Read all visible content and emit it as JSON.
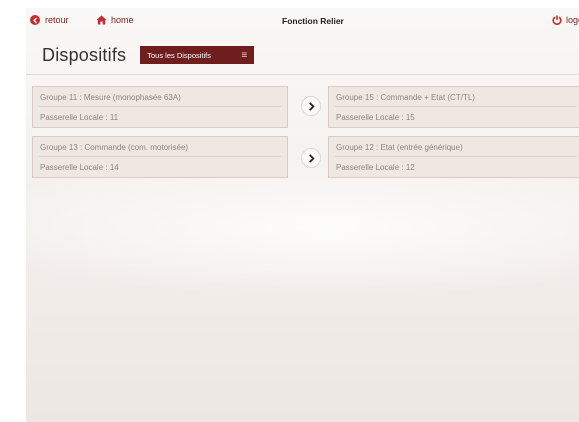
{
  "nav": {
    "retour_label": "retour",
    "home_label": "home",
    "title": "Fonction Relier",
    "logout_label": "logout"
  },
  "header": {
    "title": "Dispositifs",
    "filter_label": "Tous les Dispositifs"
  },
  "pairs": [
    {
      "left": {
        "title": "Groupe 11 : Mesure (monophasée 63A)",
        "subtitle": "Passerelle Locale : 11"
      },
      "right": {
        "title": "Groupe 15 : Commande + Etat (CT/TL)",
        "subtitle": "Passerelle Locale : 15"
      }
    },
    {
      "left": {
        "title": "Groupe 13 : Commande (com. motorisée)",
        "subtitle": "Passerelle Locale : 14"
      },
      "right": {
        "title": "Groupe 12 : Etat (entrée générique)",
        "subtitle": "Passerelle Locale : 12"
      }
    }
  ],
  "colors": {
    "accent": "#6f1e1e",
    "nav_link": "#7a1f1f",
    "icon_red": "#c72b2b",
    "card_bg": "#efe7e1"
  }
}
